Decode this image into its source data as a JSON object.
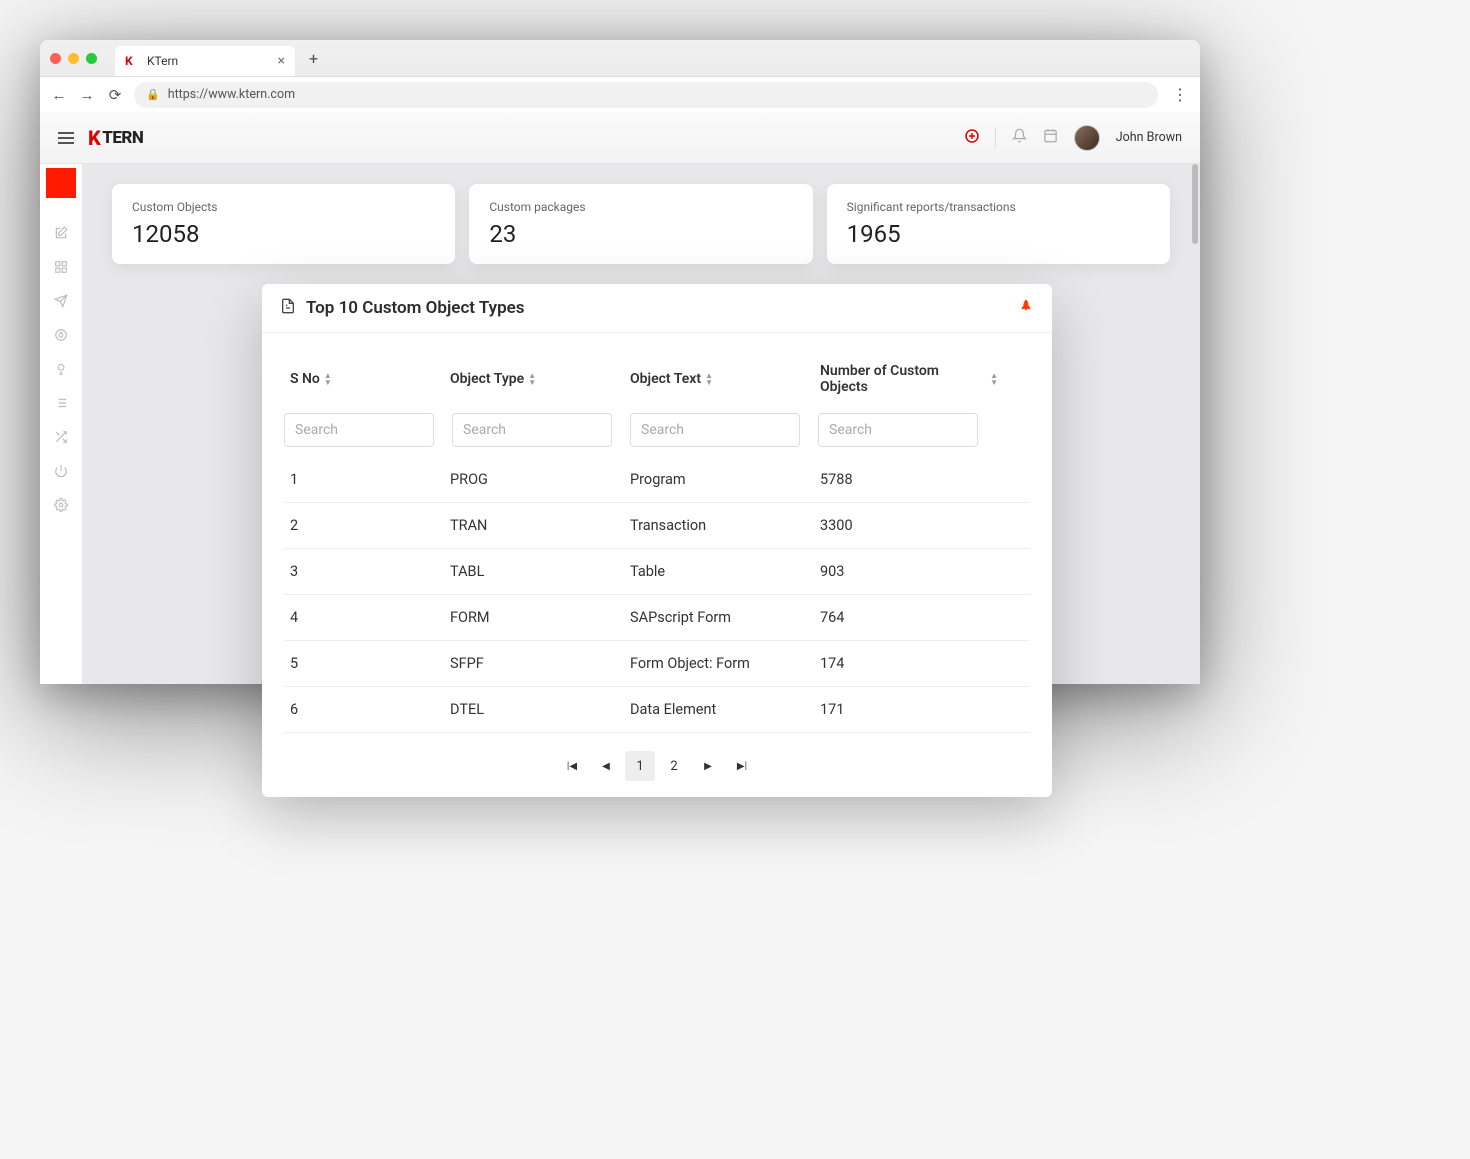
{
  "browser": {
    "tab_title": "KTern",
    "url": "https://www.ktern.com"
  },
  "header": {
    "logo_text": "TERN",
    "username": "John Brown"
  },
  "stats": [
    {
      "label": "Custom Objects",
      "value": "12058"
    },
    {
      "label": "Custom packages",
      "value": "23"
    },
    {
      "label": "Significant reports/transactions",
      "value": "1965"
    }
  ],
  "table": {
    "title": "Top 10 Custom Object Types",
    "columns": {
      "sno": "S No",
      "object_type": "Object Type",
      "object_text": "Object Text",
      "num_objects": "Number of Custom Objects"
    },
    "search_placeholder": "Search",
    "rows": [
      {
        "sno": "1",
        "type": "PROG",
        "text": "Program",
        "count": "5788"
      },
      {
        "sno": "2",
        "type": "TRAN",
        "text": "Transaction",
        "count": "3300"
      },
      {
        "sno": "3",
        "type": "TABL",
        "text": "Table",
        "count": "903"
      },
      {
        "sno": "4",
        "type": "FORM",
        "text": "SAPscript Form",
        "count": "764"
      },
      {
        "sno": "5",
        "type": "SFPF",
        "text": "Form Object: Form",
        "count": "174"
      },
      {
        "sno": "6",
        "type": "DTEL",
        "text": "Data Element",
        "count": "171"
      }
    ],
    "pagination": {
      "pages": [
        "1",
        "2"
      ],
      "current": "1"
    }
  }
}
